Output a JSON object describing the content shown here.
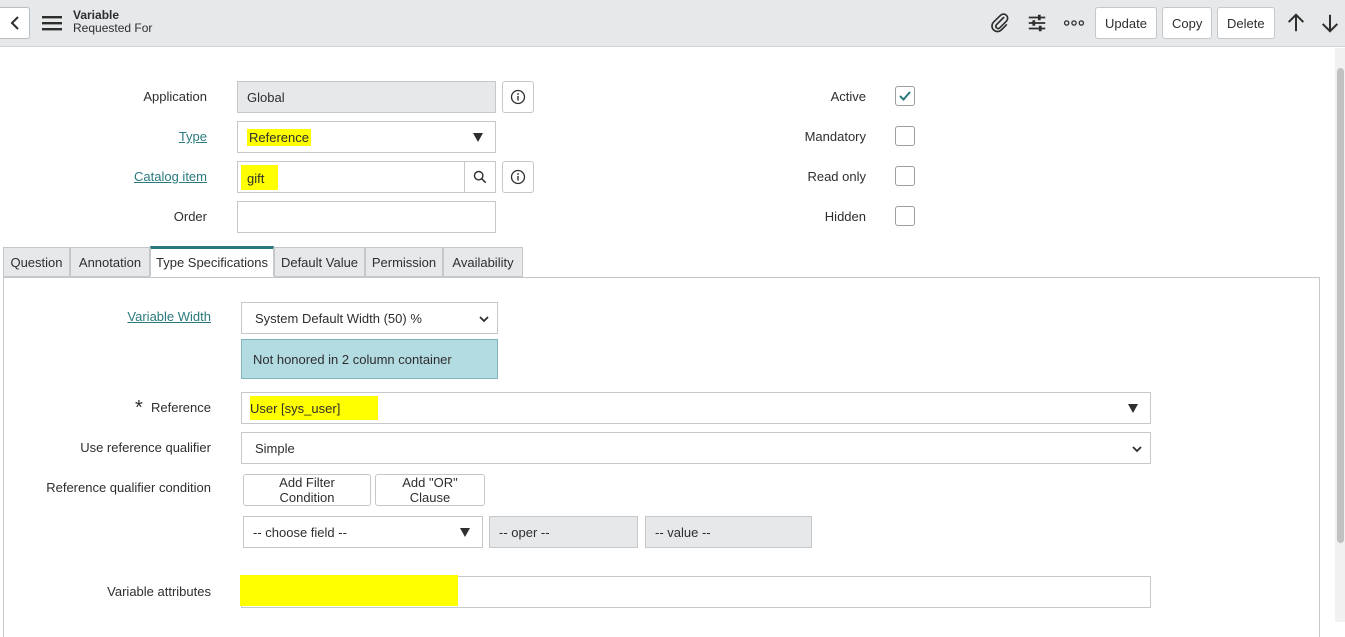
{
  "header": {
    "title": "Variable",
    "subtitle": "Requested For",
    "icons": [
      "back-icon",
      "hamburger-icon",
      "paperclip-icon",
      "sliders-icon",
      "more-icon",
      "arrow-up-icon",
      "arrow-down-icon"
    ],
    "buttons": {
      "update": "Update",
      "copy": "Copy",
      "delete": "Delete"
    }
  },
  "form": {
    "application": {
      "label": "Application",
      "value": "Global"
    },
    "type": {
      "label": "Type",
      "value": "Reference"
    },
    "catalog_item": {
      "label": "Catalog item",
      "value": "gift"
    },
    "order": {
      "label": "Order",
      "value": ""
    },
    "active": {
      "label": "Active",
      "checked": true
    },
    "mandatory": {
      "label": "Mandatory",
      "checked": false
    },
    "read_only": {
      "label": "Read only",
      "checked": false
    },
    "hidden": {
      "label": "Hidden",
      "checked": false
    }
  },
  "tabs": [
    {
      "label": "Question"
    },
    {
      "label": "Annotation"
    },
    {
      "label": "Type Specifications",
      "active": true
    },
    {
      "label": "Default Value"
    },
    {
      "label": "Permission"
    },
    {
      "label": "Availability"
    }
  ],
  "type_spec": {
    "variable_width": {
      "label": "Variable Width",
      "value": "System Default Width (50) %"
    },
    "notice": "Not honored in 2 column container",
    "reference": {
      "label": "Reference",
      "required_mark": "*",
      "value": "User [sys_user]"
    },
    "use_ref_qualifier": {
      "label": "Use reference qualifier",
      "value": "Simple"
    },
    "ref_qualifier_condition": {
      "label": "Reference qualifier condition",
      "add_filter": "Add Filter Condition",
      "add_or": "Add \"OR\" Clause",
      "choose_field": "-- choose field --",
      "oper": "-- oper --",
      "value": "-- value --"
    },
    "variable_attributes": {
      "label": "Variable attributes",
      "value": ""
    }
  },
  "colors": {
    "highlight": "#ffff00",
    "accent": "#2a7a7d",
    "notice_bg": "#b3dbe2"
  }
}
